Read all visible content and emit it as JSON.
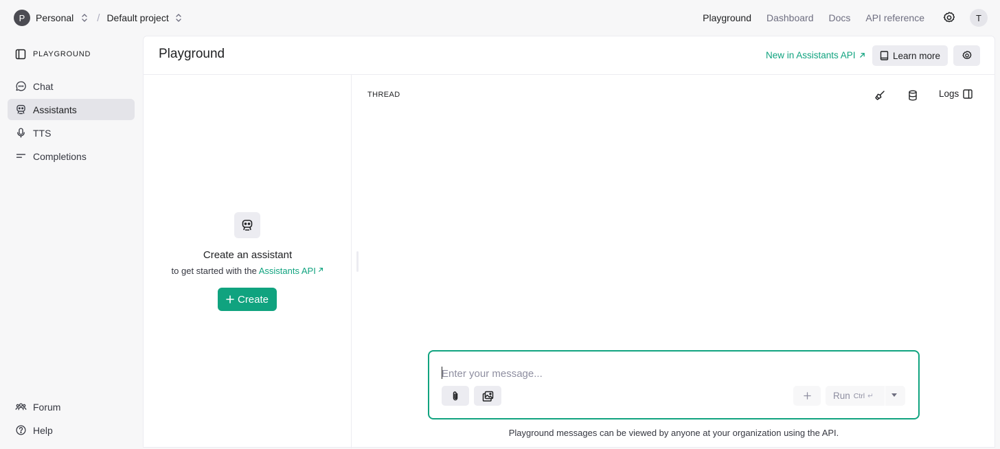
{
  "topbar": {
    "org_initial": "P",
    "org_name": "Personal",
    "separator": "/",
    "project_name": "Default project",
    "nav": [
      "Playground",
      "Dashboard",
      "Docs",
      "API reference"
    ],
    "user_initial": "T"
  },
  "sidebar": {
    "header": "PLAYGROUND",
    "items": [
      {
        "label": "Chat",
        "icon": "chat-bubble-icon"
      },
      {
        "label": "Assistants",
        "icon": "robot-icon",
        "active": true
      },
      {
        "label": "TTS",
        "icon": "microphone-icon"
      },
      {
        "label": "Completions",
        "icon": "text-lines-icon"
      }
    ],
    "footer": [
      {
        "label": "Forum",
        "icon": "people-icon"
      },
      {
        "label": "Help",
        "icon": "help-circle-icon"
      }
    ]
  },
  "main": {
    "title": "Playground",
    "new_link": "New in Assistants API",
    "learn_more": "Learn more"
  },
  "assistant_panel": {
    "title": "Create an assistant",
    "subtitle_prefix": "to get started with the",
    "subtitle_link": "Assistants API",
    "create_label": "Create"
  },
  "thread": {
    "label": "THREAD",
    "logs_label": "Logs",
    "composer": {
      "placeholder": "Enter your message...",
      "run_label": "Run",
      "run_shortcut": "Ctrl",
      "run_enter_glyph": "↵"
    },
    "footnote": "Playground messages can be viewed by anyone at your organization using the API."
  },
  "colors": {
    "accent": "#10a37f",
    "background": "#f7f7f8",
    "panel": "#ffffff",
    "active_item": "#e4e4e9"
  }
}
